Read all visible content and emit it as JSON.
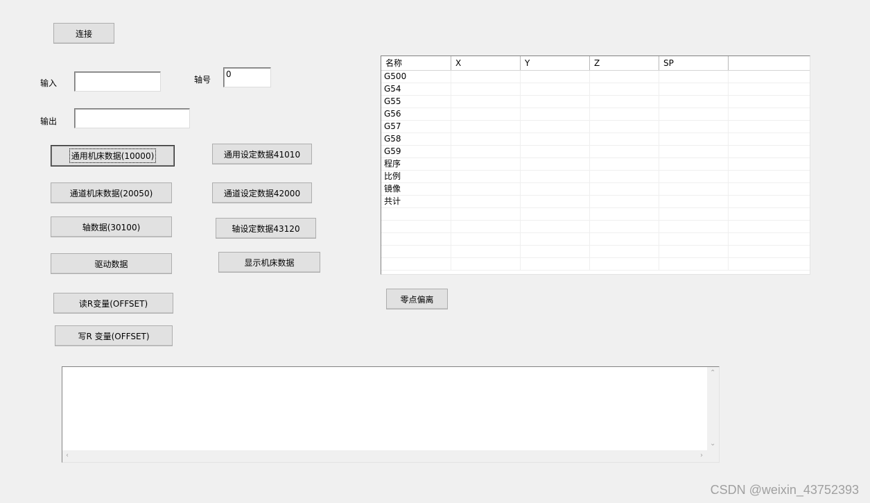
{
  "buttons": {
    "connect": "连接",
    "general_machine_data": "通用机床数据(10000)",
    "channel_machine_data": "通道机床数据(20050)",
    "axis_data": "轴数据(30100)",
    "drive_data": "驱动数据",
    "read_r_var": "读R变量(OFFSET)",
    "write_r_var": "写R 变量(OFFSET)",
    "general_setting_data": "通用设定数据41010",
    "channel_setting_data": "通道设定数据42000",
    "axis_setting_data": "轴设定数据43120",
    "show_machine_data": "显示机床数据",
    "zero_offset": "零点偏离"
  },
  "fields": {
    "input_label": "输入",
    "input_value": "",
    "output_label": "输出",
    "output_value": "",
    "axis_label": "轴号",
    "axis_value": "0"
  },
  "table": {
    "columns": [
      "名称",
      "X",
      "Y",
      "Z",
      "SP",
      ""
    ],
    "rows": [
      "G500",
      "G54",
      "G55",
      "G56",
      "G57",
      "G58",
      "G59",
      "程序",
      "比例",
      "镜像",
      "共计",
      "",
      "",
      "",
      "",
      ""
    ]
  },
  "memo": {
    "text": ""
  },
  "watermark": "CSDN @weixin_43752393"
}
